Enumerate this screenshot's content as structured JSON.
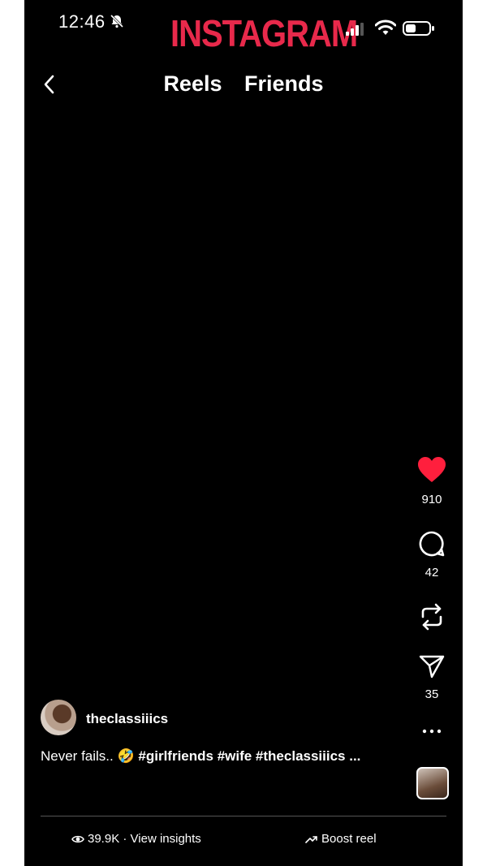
{
  "status": {
    "time": "12:46"
  },
  "brand": {
    "name": "INSTAGRAM",
    "color": "#e8294b"
  },
  "header": {
    "tabs": [
      "Reels",
      "Friends"
    ],
    "back_icon": "chevron-left-icon"
  },
  "actions": {
    "like_count": "910",
    "comment_count": "42",
    "share_count": "35",
    "like_color": "#ff1f3d"
  },
  "post": {
    "username": "theclassiiics",
    "caption_text": "Never fails.. ",
    "caption_emoji": "🤣",
    "caption_tags": "#girlfriends #wife #theclassiiics ..."
  },
  "footer": {
    "views": "39.9K · View insights",
    "boost": "Boost reel"
  }
}
